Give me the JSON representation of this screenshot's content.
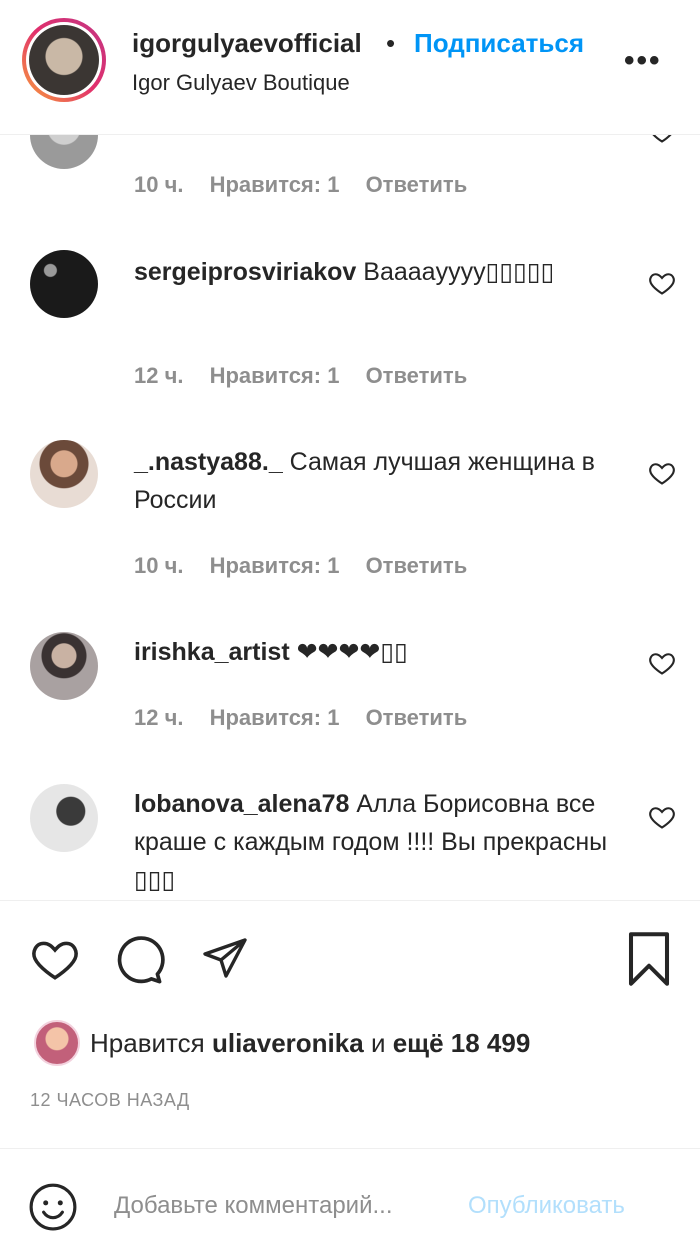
{
  "header": {
    "username": "igorgulyaevofficial",
    "separator": "•",
    "follow_label": "Подписаться",
    "subtitle": "Igor Gulyaev Boutique",
    "more_label": "•••"
  },
  "comments": [
    {
      "username": "",
      "text": "",
      "time": "10 ч.",
      "likes": "Нравится: 1",
      "reply": "Ответить"
    },
    {
      "username": "sergeiprosviriakov",
      "text": "Вааааyyyy▯▯▯▯▯",
      "time": "12 ч.",
      "likes": "Нравится: 1",
      "reply": "Ответить"
    },
    {
      "username": "_.nastya88._",
      "text": "Самая лучшая женщина в России",
      "time": "10 ч.",
      "likes": "Нравится: 1",
      "reply": "Ответить"
    },
    {
      "username": "irishka_artist",
      "text": "❤❤❤❤▯▯",
      "time": "12 ч.",
      "likes": "Нравится: 1",
      "reply": "Ответить"
    },
    {
      "username": "lobanova_alena78",
      "text": "Алла Борисовна все краше с каждым годом !!!! Вы прекрасны ▯▯▯",
      "time": "",
      "likes": "",
      "reply": ""
    }
  ],
  "likes": {
    "prefix": "Нравится",
    "user": "uliaveronika",
    "middle": "и",
    "count": "ещё 18 499"
  },
  "time_ago": "12 ЧАСОВ НАЗАД",
  "add_comment": {
    "placeholder": "Добавьте комментарий...",
    "post_label": "Опубликовать"
  }
}
